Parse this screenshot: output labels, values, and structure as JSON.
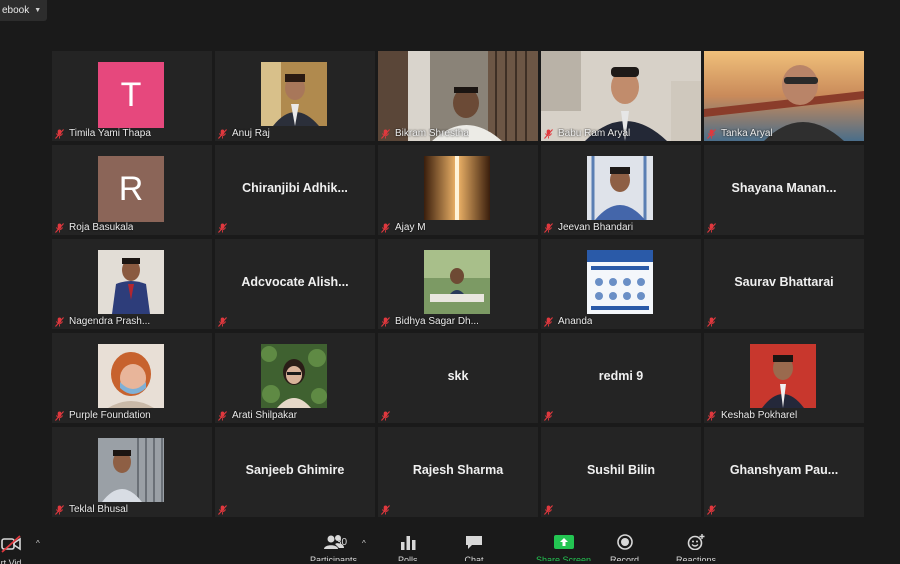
{
  "top_button": {
    "label": "ebook"
  },
  "participants": [
    {
      "name": "Timila Yami Thapa",
      "type": "avatar",
      "initial": "T",
      "color": "#e6487d"
    },
    {
      "name": "Anuj Raj",
      "type": "photo"
    },
    {
      "name": "Bikram Shrestha",
      "type": "video"
    },
    {
      "name": "Babu Ram Aryal",
      "type": "video",
      "active": true
    },
    {
      "name": "Tanka Aryal",
      "type": "video"
    },
    {
      "name": "Roja Basukala",
      "type": "avatar",
      "initial": "R",
      "color": "#8b6558"
    },
    {
      "name": "Chiranjibi Adhik...",
      "type": "name"
    },
    {
      "name": "Ajay M",
      "type": "photo"
    },
    {
      "name": "Jeevan Bhandari",
      "type": "photo"
    },
    {
      "name": "Shayana Manan...",
      "type": "name"
    },
    {
      "name": "Nagendra Prash...",
      "type": "photo"
    },
    {
      "name": "Adcvocate Alish...",
      "type": "name"
    },
    {
      "name": "Bidhya Sagar Dh...",
      "type": "photo"
    },
    {
      "name": "Ananda",
      "type": "photo"
    },
    {
      "name": "Saurav Bhattarai",
      "type": "name"
    },
    {
      "name": "Purple Foundation",
      "type": "photo"
    },
    {
      "name": "Arati Shilpakar",
      "type": "photo"
    },
    {
      "name": "skk",
      "type": "name"
    },
    {
      "name": "redmi 9",
      "type": "name"
    },
    {
      "name": "Keshab Pokharel",
      "type": "photo"
    },
    {
      "name": "Teklal Bhusal",
      "type": "photo"
    },
    {
      "name": "Sanjeeb Ghimire",
      "type": "name"
    },
    {
      "name": "Rajesh Sharma",
      "type": "name"
    },
    {
      "name": "Sushil Bilin",
      "type": "name"
    },
    {
      "name": "Ghanshyam Pau...",
      "type": "name"
    }
  ],
  "toolbar": {
    "video_label": "rt Vid",
    "participants_label": "Participants",
    "participants_count": "30",
    "polls_label": "Polls",
    "chat_label": "Chat",
    "share_label": "Share Screen",
    "record_label": "Record",
    "reactions_label": "Reactions"
  },
  "colors": {
    "active_speaker": "#b6e45a",
    "share_green": "#23c552",
    "muted_red": "#e0383e"
  }
}
